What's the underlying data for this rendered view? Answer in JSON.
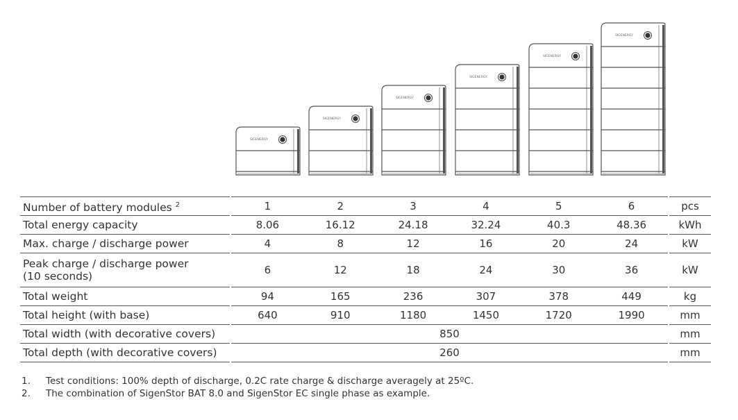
{
  "illustration": {
    "brand_logo_text": "SIGENERGY",
    "module_counts": [
      1,
      2,
      3,
      4,
      5,
      6
    ]
  },
  "table": {
    "rows": [
      {
        "label": "Number of battery modules",
        "sup": "2",
        "values": [
          "1",
          "2",
          "3",
          "4",
          "5",
          "6"
        ],
        "unit": "pcs"
      },
      {
        "label": "Total energy capacity",
        "values": [
          "8.06",
          "16.12",
          "24.18",
          "32.24",
          "40.3",
          "48.36"
        ],
        "unit": "kWh"
      },
      {
        "label": "Max. charge / discharge power",
        "values": [
          "4",
          "8",
          "12",
          "16",
          "20",
          "24"
        ],
        "unit": "kW"
      },
      {
        "label": "Peak charge / discharge power",
        "label2": "(10 seconds)",
        "values": [
          "6",
          "12",
          "18",
          "24",
          "30",
          "36"
        ],
        "unit": "kW"
      },
      {
        "label": "Total weight",
        "values": [
          "94",
          "165",
          "236",
          "307",
          "378",
          "449"
        ],
        "unit": "kg"
      },
      {
        "label": "Total height (with base)",
        "values": [
          "640",
          "910",
          "1180",
          "1450",
          "1720",
          "1990"
        ],
        "unit": "mm"
      },
      {
        "label": "Total width (with decorative covers)",
        "value_all": "850",
        "unit": "mm"
      },
      {
        "label": "Total depth (with decorative covers)",
        "value_all": "260",
        "unit": "mm"
      }
    ]
  },
  "footnotes": [
    {
      "num": "1.",
      "text": "Test conditions: 100% depth of discharge, 0.2C rate charge & discharge averagely at 25ºC."
    },
    {
      "num": "2.",
      "text": "The combination of SigenStor BAT 8.0 and SigenStor EC single phase as example."
    }
  ]
}
